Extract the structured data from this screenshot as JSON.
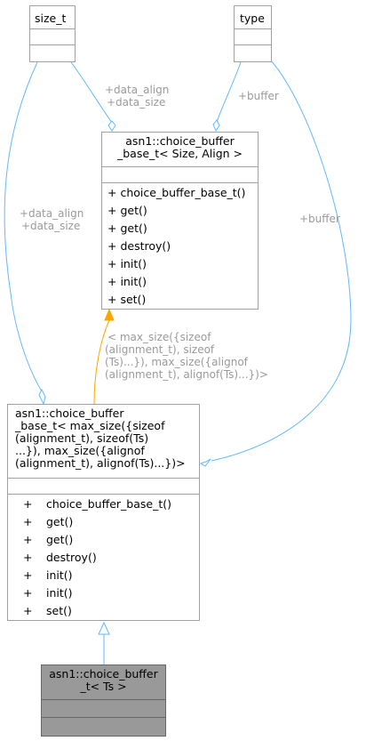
{
  "classes": {
    "size_t": {
      "name": "size_t"
    },
    "type": {
      "name": "type"
    },
    "base_template": {
      "name_lines": [
        "asn1::choice_buffer",
        "_base_t< Size, Align >"
      ],
      "methods": [
        "+ choice_buffer_base_t()",
        "+ get()",
        "+ get()",
        "+ destroy()",
        "+ init()",
        "+ init()",
        "+ set()"
      ]
    },
    "base_instance": {
      "name_lines": [
        "asn1::choice_buffer",
        "_base_t< max_size({sizeof",
        "(alignment_t), sizeof(Ts)",
        "...}), max_size({alignof",
        "(alignment_t), alignof(Ts)...})>"
      ],
      "methods": [
        {
          "vis": "+",
          "name": "choice_buffer_base_t()"
        },
        {
          "vis": "+",
          "name": "get()"
        },
        {
          "vis": "+",
          "name": "get()"
        },
        {
          "vis": "+",
          "name": "destroy()"
        },
        {
          "vis": "+",
          "name": "init()"
        },
        {
          "vis": "+",
          "name": "init()"
        },
        {
          "vis": "+",
          "name": "set()"
        }
      ]
    },
    "choice_buffer": {
      "name_lines": [
        "asn1::choice_buffer",
        "_t< Ts >"
      ]
    }
  },
  "edge_labels": {
    "size_to_base": [
      "+data_align",
      "+data_size"
    ],
    "type_to_base": [
      "+buffer"
    ],
    "size_to_instance": [
      "+data_align",
      "+data_size"
    ],
    "type_to_instance": [
      "+buffer"
    ],
    "template_binding": [
      "< max_size({sizeof",
      "(alignment_t), sizeof",
      "(Ts)...}), max_size({alignof",
      "(alignment_t), alignof(Ts)...})>"
    ]
  },
  "colors": {
    "edge": "#63b8ff",
    "template_edge": "#ffa500",
    "border": "#a0a0a0",
    "highlight_fill": "#999999",
    "label": "#9a9a9a"
  }
}
